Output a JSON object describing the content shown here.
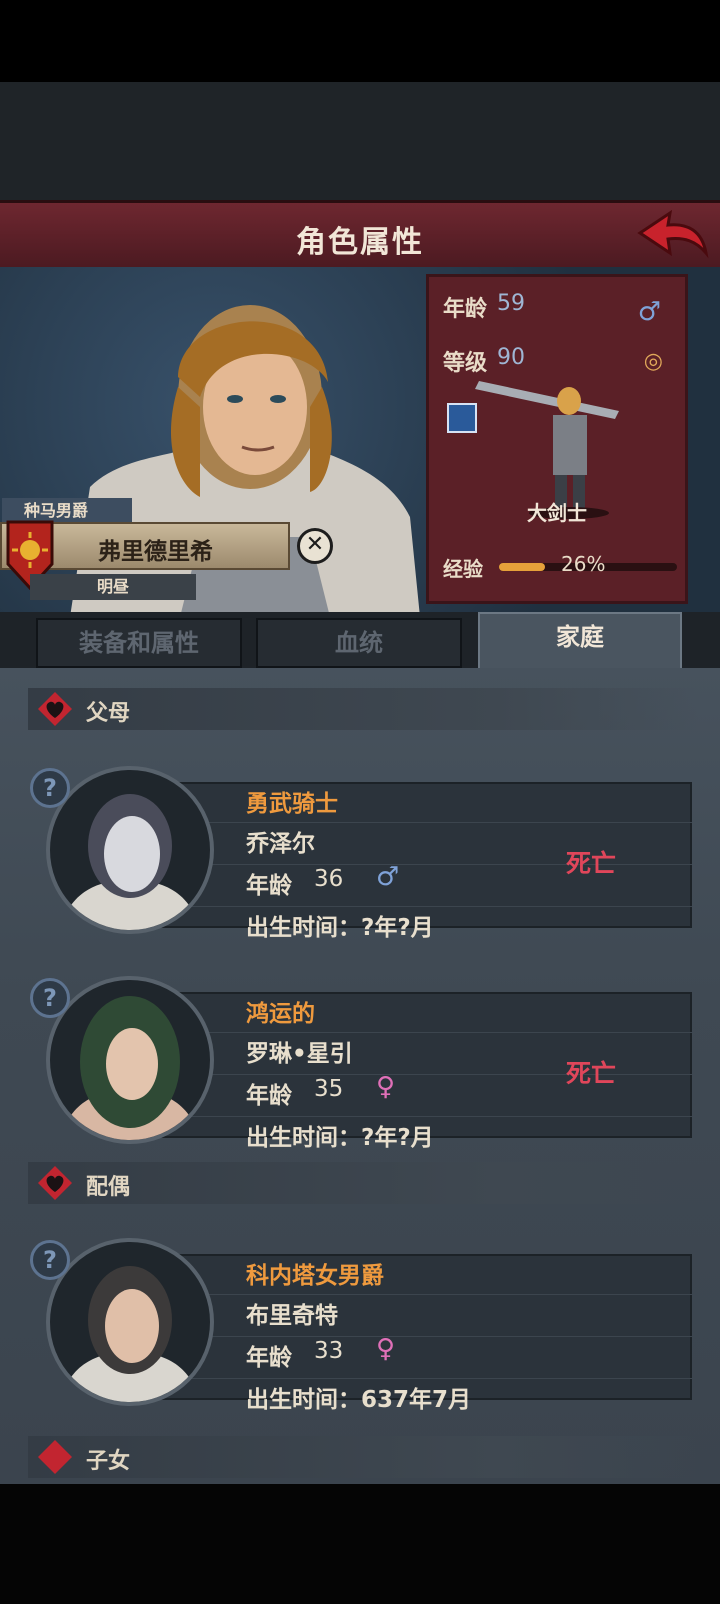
{
  "header": {
    "title": "角色属性"
  },
  "character": {
    "title": "种马男爵",
    "name": "弗里德里希",
    "epithet": "明昼",
    "age_label": "年龄",
    "age": "59",
    "level_label": "等级",
    "level": "90",
    "class_name": "大剑士",
    "xp_label": "经验",
    "xp_value": "26%",
    "xp_fraction": 0.26
  },
  "tabs": [
    {
      "label": "装备和属性"
    },
    {
      "label": "血统"
    },
    {
      "label": "家庭"
    }
  ],
  "sections": {
    "parents": "父母",
    "spouse": "配偶",
    "children": "子女"
  },
  "members": [
    {
      "title": "勇武骑士",
      "name": "乔泽尔",
      "age_label": "年龄",
      "age": "36",
      "gender": "♂",
      "birth": "出生时间：?年?月",
      "status": "死亡"
    },
    {
      "title": "鸿运的",
      "name": "罗琳•星引",
      "age_label": "年龄",
      "age": "35",
      "gender": "♀",
      "birth": "出生时间：?年?月",
      "status": "死亡"
    },
    {
      "title": "科内塔女男爵",
      "name": "布里奇特",
      "age_label": "年龄",
      "age": "33",
      "gender": "♀",
      "birth": "出生时间：637年7月",
      "status": ""
    }
  ],
  "colors": {
    "male": "#7fa2d8",
    "female": "#e070b8",
    "dead": "#e0465a",
    "title_orange": "#ef9a3e"
  }
}
